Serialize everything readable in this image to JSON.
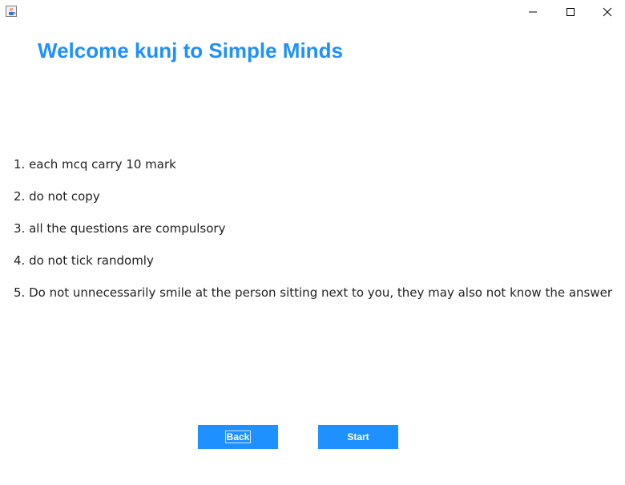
{
  "window": {
    "icons": {
      "app": "java-cup-icon",
      "minimize": "minimize-icon",
      "maximize": "maximize-icon",
      "close": "close-icon"
    }
  },
  "main": {
    "welcome_text": "Welcome kunj to Simple Minds",
    "rules": [
      "1. each mcq carry 10 mark",
      "2. do not copy",
      "3. all the questions are compulsory",
      "4. do not tick randomly",
      "5. Do not unnecessarily smile at the person sitting next to you, they may also not know the answer"
    ]
  },
  "buttons": {
    "back_label": "Back",
    "start_label": "Start"
  },
  "colors": {
    "accent": "#1e90ff",
    "text": "#222222",
    "background": "#ffffff"
  }
}
